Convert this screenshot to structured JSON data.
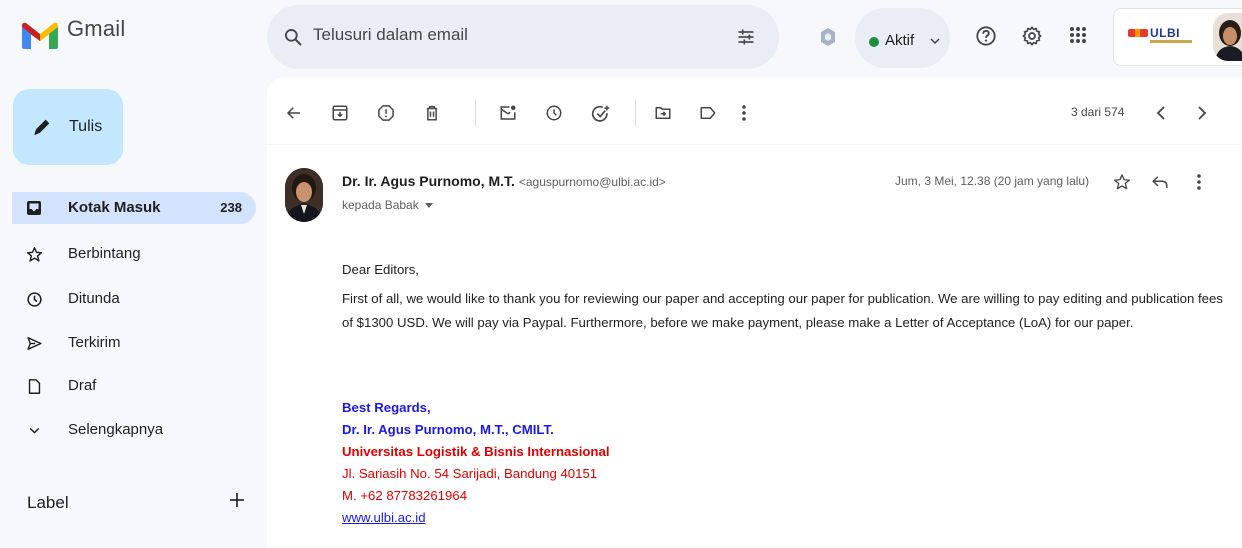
{
  "app": {
    "name": "Gmail"
  },
  "search": {
    "placeholder": "Telusuri dalam email"
  },
  "status": {
    "label": "Aktif"
  },
  "org": {
    "name": "ULBI"
  },
  "sidebar": {
    "compose_label": "Tulis",
    "items": [
      {
        "label": "Kotak Masuk",
        "count": "238",
        "icon": "inbox-icon",
        "active": true
      },
      {
        "label": "Berbintang",
        "icon": "star-icon"
      },
      {
        "label": "Ditunda",
        "icon": "clock-icon"
      },
      {
        "label": "Terkirim",
        "icon": "send-icon"
      },
      {
        "label": "Draf",
        "icon": "draft-icon"
      },
      {
        "label": "Selengkapnya",
        "icon": "chevron-down-icon"
      }
    ],
    "labels_heading": "Label"
  },
  "toolbar": {
    "pager": "3 dari 574"
  },
  "email": {
    "sender_name": "Dr. Ir. Agus Purnomo, M.T.",
    "sender_email": "<aguspurnomo@ulbi.ac.id>",
    "to_line": "kepada Babak",
    "date": "Jum, 3 Mei, 12.38 (20 jam yang lalu)",
    "greeting": "Dear Editors,",
    "paragraph": "First of all, we would like to thank you for reviewing our paper and accepting our paper for publication. We are willing to pay editing and publication fees of $1300 USD. We will pay via Paypal. Furthermore, before we make payment, please make a Letter of Acceptance (LoA) for our paper.",
    "signature": {
      "closing": "Best Regards,",
      "name": "Dr. Ir. Agus Purnomo, M.T., CMILT.",
      "institution": "Universitas Logistik & Bisnis Internasional",
      "address": "Jl. Sariasih No. 54 Sarijadi, Bandung 40151",
      "phone": "M. +62 87783261964",
      "website": "www.ulbi.ac.id"
    }
  },
  "colors": {
    "sidebar_active": "#d3e3fd",
    "compose": "#c2e7ff",
    "signature_blue": "#1a1ae0",
    "signature_red": "#e00000",
    "status_green": "#1e8e3e"
  }
}
